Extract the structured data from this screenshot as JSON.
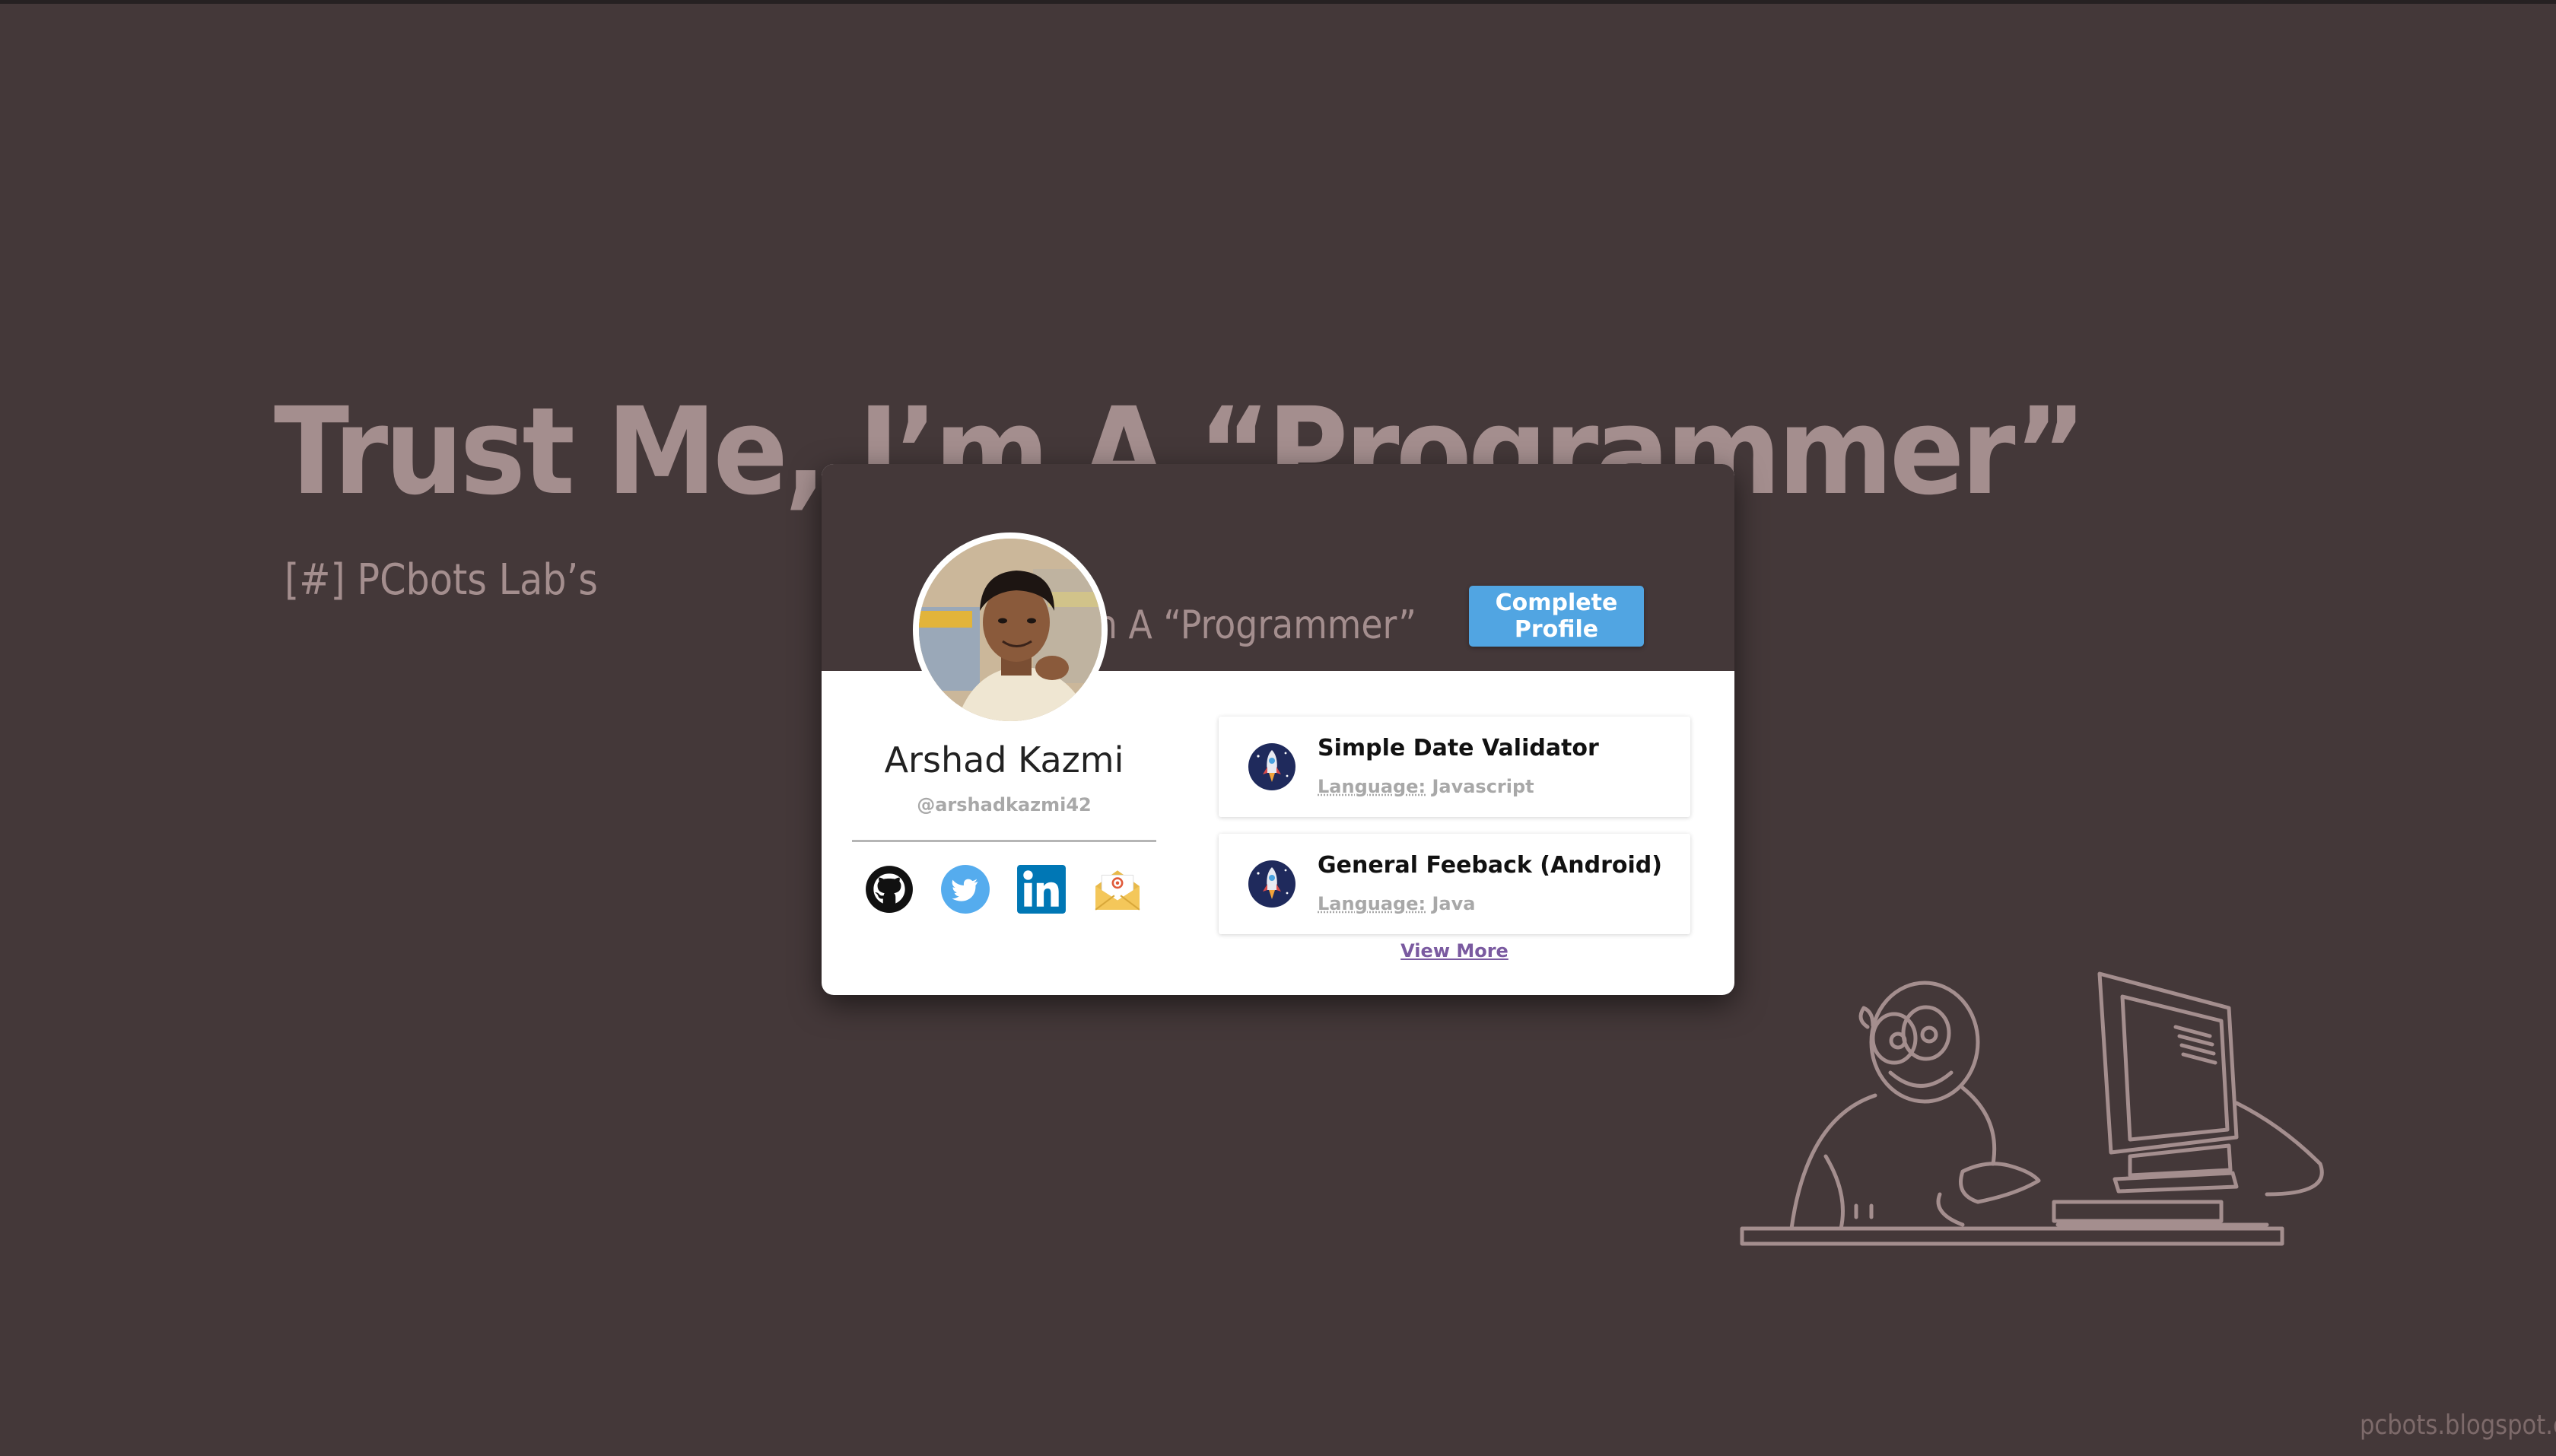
{
  "background": {
    "title": "Trust Me, I’m A “Programmer”",
    "subtitle": "[#] PCbots Lab’s",
    "watermark": "pcbots.blogspot.com"
  },
  "card": {
    "header_ghost_text": "n A “Programmer”",
    "complete_profile_label": "Complete Profile",
    "name": "Arshad Kazmi",
    "handle": "@arshadkazmi42",
    "socials": [
      {
        "icon": "github-icon"
      },
      {
        "icon": "twitter-icon"
      },
      {
        "icon": "linkedin-icon"
      },
      {
        "icon": "email-icon"
      }
    ],
    "projects": [
      {
        "title": "Simple Date Validator",
        "language_label": "Language:",
        "language": "Javascript"
      },
      {
        "title": "General Feeback (Android)",
        "language_label": "Language:",
        "language": "Java"
      }
    ],
    "view_more_label": "View More"
  },
  "colors": {
    "background": "#443839",
    "accent_button": "#51a5e2",
    "link": "#7a5aa0",
    "twitter": "#55acee",
    "linkedin": "#0077b5"
  }
}
